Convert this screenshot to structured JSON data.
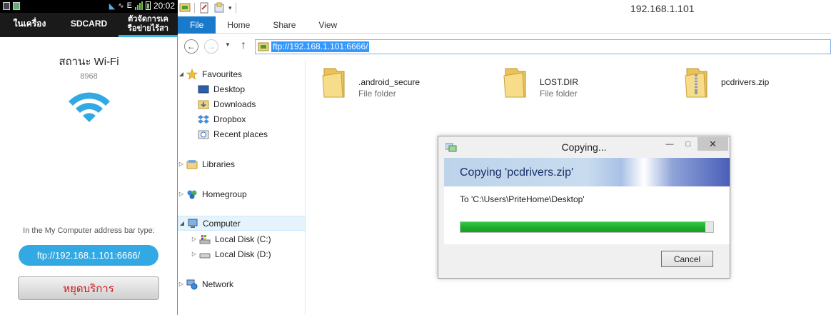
{
  "phone": {
    "status_time": "20:02",
    "status_net": "E",
    "tabs": [
      "ในเครื่อง",
      "SDCARD",
      "ตัวจัดการเครือข่ายไร้สา"
    ],
    "tab_active_line1": "ตัวจัดการเค",
    "tab_active_line2": "รือข่ายไร้สา",
    "wifi_state": "สถานะ Wi-Fi",
    "port": "8968",
    "address_hint": "In the My Computer address bar type:",
    "ftp_address": "ftp://192.168.1.101:6666/",
    "stop_button": "หยุดบริการ",
    "accent_color": "#33b5e5"
  },
  "explorer": {
    "window_title": "192.168.1.101",
    "ribbon_tabs": [
      "File",
      "Home",
      "Share",
      "View"
    ],
    "address": "ftp://192.168.1.101:6666/",
    "nav_pane": {
      "favourites": "Favourites",
      "favourites_items": [
        "Desktop",
        "Downloads",
        "Dropbox",
        "Recent places"
      ],
      "libraries": "Libraries",
      "homegroup": "Homegroup",
      "computer": "Computer",
      "computer_items": [
        "Local Disk (C:)",
        "Local Disk (D:)"
      ],
      "network": "Network"
    },
    "files": [
      {
        "name": ".android_secure",
        "type": "File folder",
        "icon": "folder-icon"
      },
      {
        "name": "LOST.DIR",
        "type": "File folder",
        "icon": "folder-icon"
      },
      {
        "name": "pcdrivers.zip",
        "type": "",
        "icon": "zip-folder-icon"
      }
    ]
  },
  "copy_dialog": {
    "title": "Copying...",
    "heading": "Copying 'pcdrivers.zip'",
    "destination": "To 'C:\\Users\\PriteHome\\Desktop'",
    "progress_fraction": 0.97,
    "cancel_label": "Cancel",
    "progress_color": "#1fae2c"
  }
}
